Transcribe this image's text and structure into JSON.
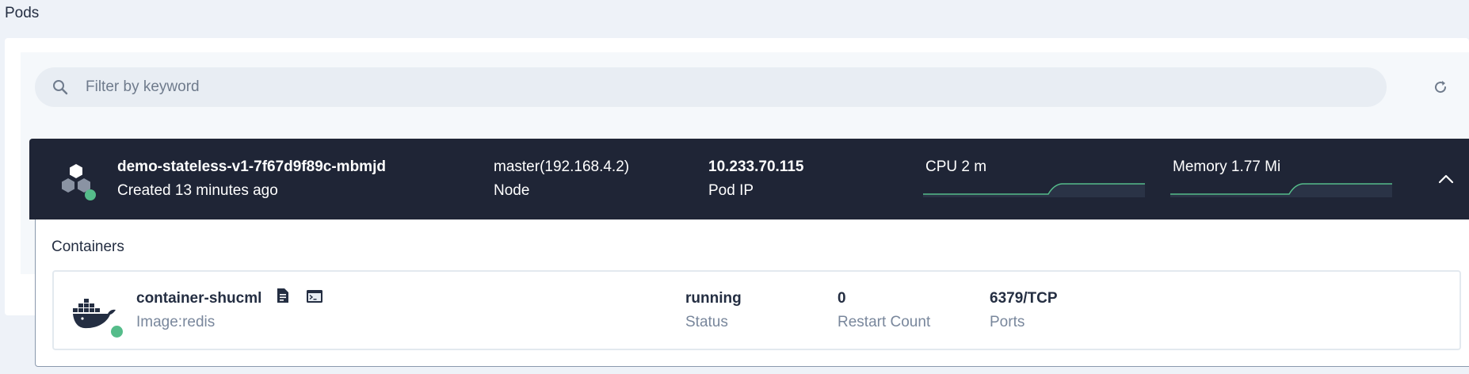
{
  "section": {
    "title": "Pods"
  },
  "search": {
    "placeholder": "Filter by keyword",
    "value": ""
  },
  "pod": {
    "name": "demo-stateless-v1-7f67d9f89c-mbmjd",
    "created": "Created 13 minutes ago",
    "node_value": "master(192.168.4.2)",
    "node_label": "Node",
    "ip_value": "10.233.70.115",
    "ip_label": "Pod IP",
    "cpu_label": "CPU 2 m",
    "memory_label": "Memory 1.77 Mi",
    "status_color": "#55bc8a"
  },
  "containers": {
    "title": "Containers",
    "items": [
      {
        "name": "container-shucml",
        "image": "Image:redis",
        "status_value": "running",
        "status_label": "Status",
        "restart_value": "0",
        "restart_label": "Restart Count",
        "ports_value": "6379/TCP",
        "ports_label": "Ports",
        "icons": [
          "log-file-icon",
          "terminal-icon"
        ]
      }
    ]
  },
  "colors": {
    "accent_green": "#55bc8a",
    "pod_header_bg": "#1f2536",
    "page_bg": "#eef2f8"
  }
}
